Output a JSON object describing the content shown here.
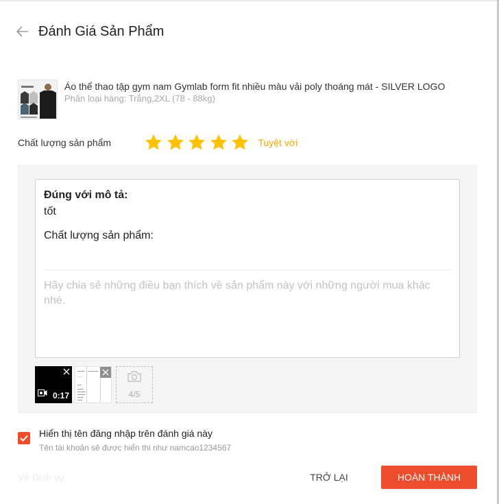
{
  "header": {
    "title": "Đánh Giá Sản Phẩm",
    "back_icon": "arrow-left-icon"
  },
  "product": {
    "name": "Áo thể thao tập gym nam Gymlab form fit nhiều màu vải poly thoáng mát - SILVER LOGO",
    "variant": "Phân loại hàng: Trắng,2XL (78 - 88kg)"
  },
  "rating": {
    "label": "Chất lượng sản phẩm",
    "stars": 5,
    "max_stars": 5,
    "text": "Tuyệt vời",
    "star_color": "#ffc107"
  },
  "review": {
    "matches_description_label": "Đúng với mô tả:",
    "matches_description_value": "tốt",
    "quality_label": "Chất lượng sản phẩm:",
    "placeholder": "Hãy chia sẻ những điều bạn thích về sản phẩm này với những người mua khác nhé."
  },
  "media": {
    "video_duration": "0:17",
    "count": "4/5"
  },
  "show_username": {
    "checked": true,
    "label": "Hiển thị tên đăng nhập trên đánh giá này",
    "note": "Tên tài khoản sẽ được hiển thị như namcao1234567"
  },
  "footer": {
    "ghost_text": "Về Dịch vụ",
    "back_label": "TRỞ LẠI",
    "complete_label": "HOÀN THÀNH"
  },
  "colors": {
    "accent": "#ee4d2d",
    "star": "#ffc107",
    "rating_text": "#f6a700"
  }
}
